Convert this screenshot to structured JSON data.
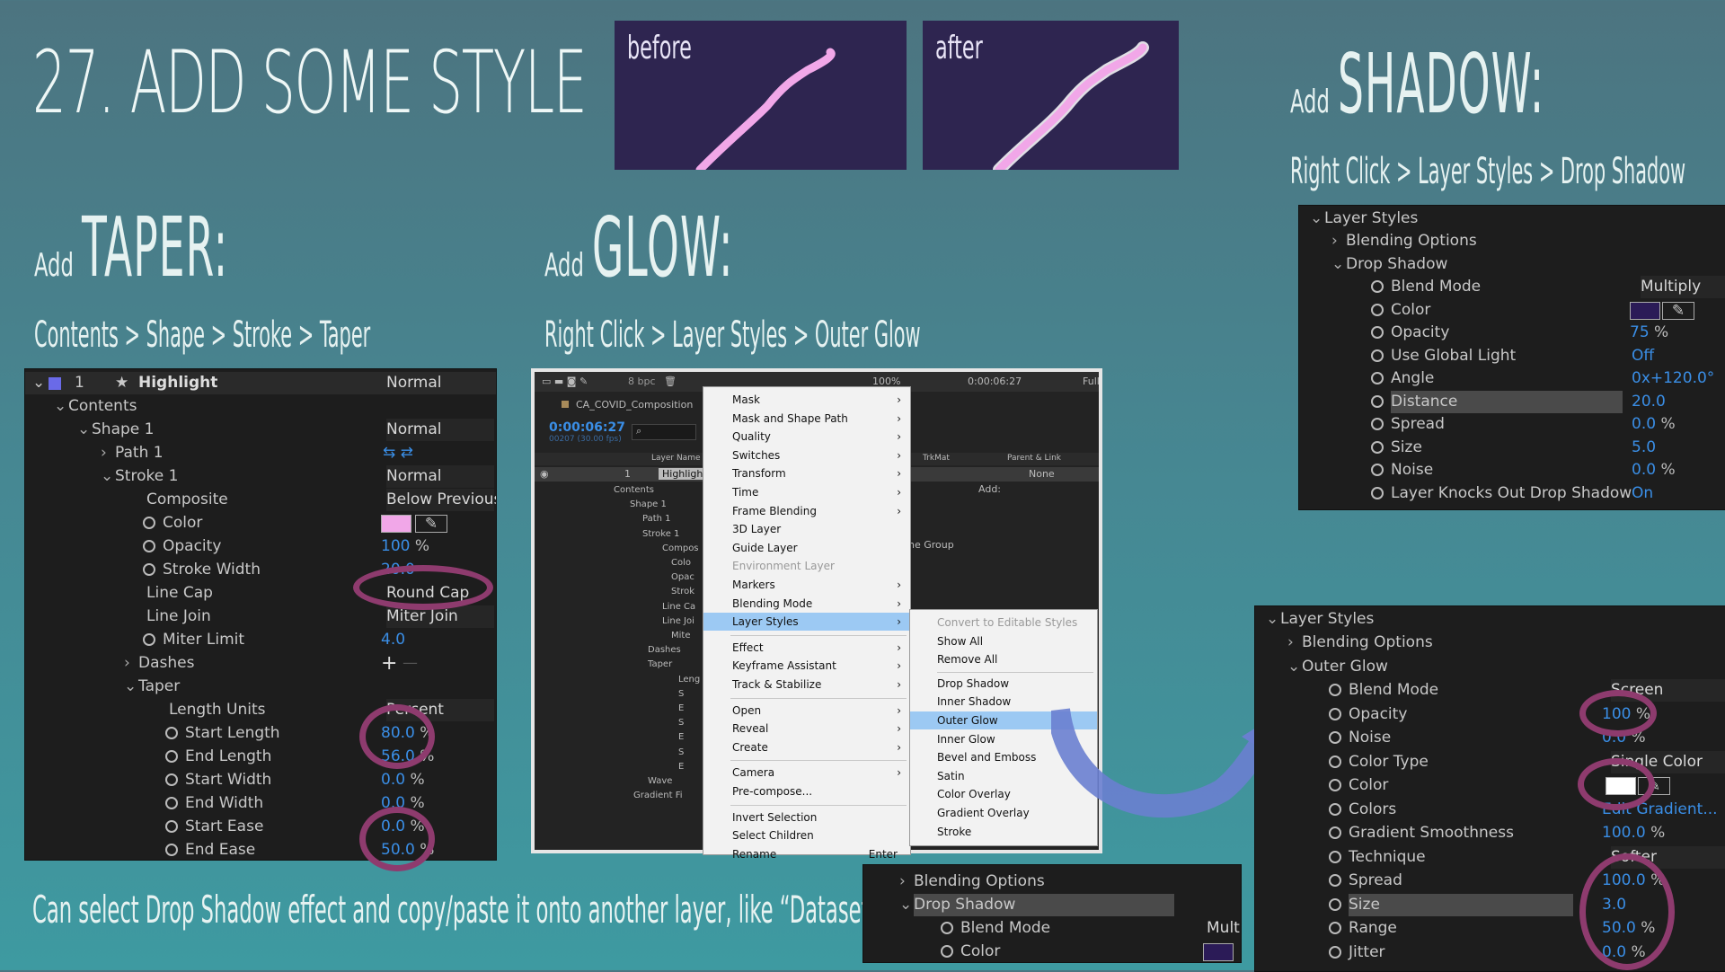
{
  "title": "27. ADD SOME STYLE",
  "previews": {
    "before": "before",
    "after": "after"
  },
  "taper": {
    "add": "Add",
    "word": "TAPER:",
    "path": "Contents > Shape > Stroke > Taper"
  },
  "glow": {
    "add": "Add",
    "word": "GLOW:",
    "path": "Right Click > Layer Styles > Outer Glow"
  },
  "shadow": {
    "add": "Add",
    "word": "SHADOW:",
    "path": "Right Click > Layer Styles > Drop Shadow"
  },
  "footnote": "Can select Drop Shadow effect and copy/paste it onto another layer, like “Dataset”.",
  "colors": {
    "pink": "#f1a7e8",
    "ring": "#8e3b6e",
    "blue": "#3a8ee6",
    "swatch_purple": "#2b1b57"
  },
  "taper_panel": {
    "layer_num": "1",
    "layer_name": "Highlight",
    "layer_mode": "Normal",
    "contents": "Contents",
    "shape": "Shape 1",
    "shape_mode": "Normal",
    "path": "Path 1",
    "stroke": "Stroke 1",
    "stroke_mode": "Normal",
    "composite": "Composite",
    "composite_val": "Below Previous",
    "color": "Color",
    "opacity": "Opacity",
    "opacity_val": "100",
    "stroke_width": "Stroke Width",
    "stroke_width_val": "20.0",
    "line_cap": "Line Cap",
    "line_cap_val": "Round Cap",
    "line_join": "Line Join",
    "line_join_val": "Miter Join",
    "miter": "Miter Limit",
    "miter_val": "4.0",
    "dashes": "Dashes",
    "taper": "Taper",
    "length_units": "Length Units",
    "length_units_val": "Percent",
    "start_length": "Start Length",
    "start_length_val": "80.0",
    "end_length": "End Length",
    "end_length_val": "56.0",
    "start_width": "Start Width",
    "start_width_val": "0.0",
    "end_width": "End Width",
    "end_width_val": "0.0",
    "start_ease": "Start Ease",
    "start_ease_val": "0.0",
    "end_ease": "End Ease",
    "end_ease_val": "50.0",
    "pct": "%"
  },
  "timeline": {
    "bpc": "8 bpc",
    "zoom": "100%",
    "time": "0:00:06:27",
    "quality": "Full",
    "comp": "CA_COVID_Composition",
    "timecode": "0:00:06:27",
    "frames": "00207 (30.00 fps)",
    "col_layer": "Layer Name",
    "col_trkmat": "TrkMat",
    "col_parent": "Parent & Link",
    "layer": "Highligh",
    "parent_val": "None",
    "add": "Add:",
    "rows": [
      "Contents",
      "Shape 1",
      "Path 1",
      "Stroke 1",
      "Compos",
      "Colo",
      "Opac",
      "Strok",
      "Line Ca",
      "Line Joi",
      "Mite",
      "Dashes",
      "Taper",
      "Leng",
      "S",
      "E",
      "S",
      "E",
      "S",
      "E",
      "Wave",
      "Gradient Fi"
    ],
    "group": "he Group"
  },
  "context_menu": [
    "Mask",
    "Mask and Shape Path",
    "Quality",
    "Switches",
    "Transform",
    "Time",
    "Frame Blending",
    "3D Layer",
    "Guide Layer",
    "Environment Layer",
    "Markers",
    "Blending Mode",
    "Layer Styles",
    "Effect",
    "Keyframe Assistant",
    "Track & Stabilize",
    "Open",
    "Reveal",
    "Create",
    "Camera",
    "Pre-compose...",
    "Invert Selection",
    "Select Children",
    "Rename"
  ],
  "rename_shortcut": "Enter",
  "submenu": [
    "Convert to Editable Styles",
    "Show All",
    "Remove All",
    "Drop Shadow",
    "Inner Shadow",
    "Outer Glow",
    "Inner Glow",
    "Bevel and Emboss",
    "Satin",
    "Color Overlay",
    "Gradient Overlay",
    "Stroke"
  ],
  "shadow_panel": {
    "layer_styles": "Layer Styles",
    "blending": "Blending Options",
    "drop_shadow": "Drop Shadow",
    "blend_mode": "Blend Mode",
    "blend_mode_val": "Multiply",
    "color": "Color",
    "opacity": "Opacity",
    "opacity_val": "75",
    "global": "Use Global Light",
    "global_val": "Off",
    "angle": "Angle",
    "angle_val": "0x+120.0°",
    "distance": "Distance",
    "distance_val": "20.0",
    "spread": "Spread",
    "spread_val": "0.0",
    "size": "Size",
    "size_val": "5.0",
    "noise": "Noise",
    "noise_val": "0.0",
    "knocks": "Layer Knocks Out Drop Shadow",
    "knocks_val": "On",
    "pct": "%"
  },
  "mini_panel": {
    "blending": "Blending Options",
    "drop_shadow": "Drop Shadow",
    "blend_mode": "Blend Mode",
    "blend_val": "Mult",
    "color": "Color"
  },
  "glow_panel": {
    "layer_styles": "Layer Styles",
    "blending": "Blending Options",
    "outer_glow": "Outer Glow",
    "blend_mode": "Blend Mode",
    "blend_mode_val": "Screen",
    "opacity": "Opacity",
    "opacity_val": "100",
    "noise": "Noise",
    "noise_val": "0.0",
    "color_type": "Color Type",
    "color_type_val": "Single Color",
    "color": "Color",
    "colors": "Colors",
    "colors_val": "Edit Gradient...",
    "smooth": "Gradient Smoothness",
    "smooth_val": "100.0",
    "technique": "Technique",
    "technique_val": "Softer",
    "spread": "Spread",
    "spread_val": "100.0",
    "size": "Size",
    "size_val": "3.0",
    "range": "Range",
    "range_val": "50.0",
    "jitter": "Jitter",
    "jitter_val": "0.0",
    "pct": "%"
  }
}
